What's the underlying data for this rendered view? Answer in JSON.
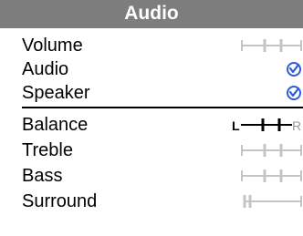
{
  "title": "Audio",
  "menu": {
    "volume": {
      "label": "Volume"
    },
    "audio": {
      "label": "Audio",
      "checked": true
    },
    "speaker": {
      "label": "Speaker",
      "checked": true
    },
    "balance": {
      "label": "Balance",
      "left_marker": "L",
      "right_marker": "R"
    },
    "treble": {
      "label": "Treble"
    },
    "bass": {
      "label": "Bass"
    },
    "surround": {
      "label": "Surround"
    }
  },
  "colors": {
    "header_bg": "#7d7d7d",
    "header_text": "#ffffff",
    "check_blue": "#2f5bd8",
    "slider_gray": "#c4c4c4"
  }
}
